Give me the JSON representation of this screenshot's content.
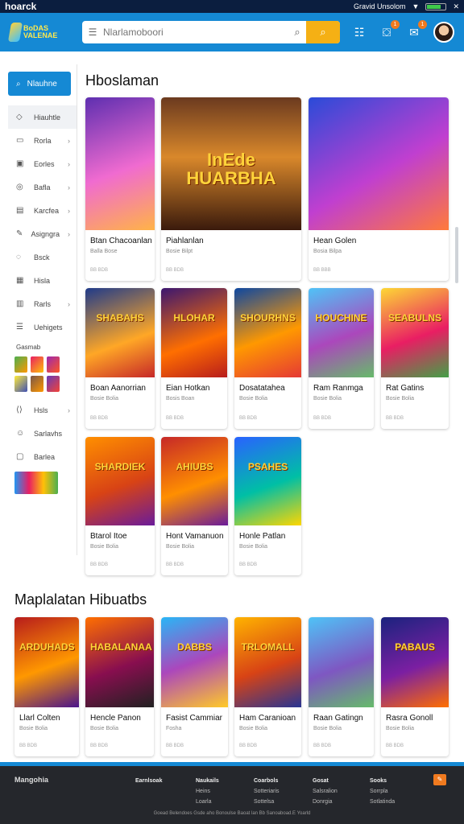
{
  "status_bar": {
    "app_name": "hoarck",
    "right_text": "Gravid Unsolom"
  },
  "header": {
    "logo_text": "BoDAS VALENAE",
    "search_placeholder": "Nlarlamoboori",
    "icons": [
      "menu-icon",
      "search-icon",
      "list-icon",
      "gift-icon",
      "notification-icon"
    ],
    "badges": [
      "1",
      "1"
    ]
  },
  "sidebar": {
    "home_label": "Nlauhne",
    "items": [
      {
        "label": "Hiauhtle",
        "icon": "tag-icon",
        "chevron": false
      },
      {
        "label": "Rorla",
        "icon": "folder-icon",
        "chevron": true
      },
      {
        "label": "Eorles",
        "icon": "image-icon",
        "chevron": true
      },
      {
        "label": "Bafla",
        "icon": "controller-icon",
        "chevron": true
      },
      {
        "label": "Karcfea",
        "icon": "chart-icon",
        "chevron": true
      },
      {
        "label": "Asigngra",
        "icon": "edit-icon",
        "chevron": true
      },
      {
        "label": "Bsck",
        "icon": "chat-icon",
        "chevron": false
      },
      {
        "label": "Hisla",
        "icon": "grid-icon",
        "chevron": false
      },
      {
        "label": "Rarls",
        "icon": "calendar-icon",
        "chevron": true
      },
      {
        "label": "Uehigets",
        "icon": "list-icon",
        "chevron": false
      }
    ],
    "section_label": "Gasmab",
    "bottom_items": [
      {
        "label": "Hsls",
        "icon": "code-icon",
        "chevron": true
      },
      {
        "label": "Sarlavhs",
        "icon": "avatar-icon",
        "chevron": false
      },
      {
        "label": "Barlea",
        "icon": "box-icon",
        "chevron": false
      }
    ]
  },
  "section1": {
    "title": "Hboslaman",
    "cards": [
      {
        "title": "Btan Chacoanlan",
        "sub": "Balla Bose",
        "meta": "BB BDB",
        "art_text": ""
      },
      {
        "title": "Piahlanlan",
        "sub": "Bosie Bilpt",
        "meta": "BB BDB",
        "art_text": "InEde HUARBHA"
      },
      {
        "title": "Hean Golen",
        "sub": "Bosia Bilpa",
        "meta": "BB BBB",
        "art_text": ""
      },
      {
        "title": "Boan Aanorrian",
        "sub": "Bosie Bolia",
        "meta": "BB BDB",
        "art_text": "SHABAHS"
      },
      {
        "title": "Eian Hotkan",
        "sub": "Bosis Boan",
        "meta": "BB BDB",
        "art_text": "HLOHAR"
      },
      {
        "title": "Dosatatahea",
        "sub": "Bosie Bolia",
        "meta": "BB BDB",
        "art_text": "SHOURHNS"
      },
      {
        "title": "Ram Ranmga",
        "sub": "Bosie Bolia",
        "meta": "BB BDB",
        "art_text": "HOUCHINE"
      },
      {
        "title": "Rat Gatins",
        "sub": "Bosie Bolia",
        "meta": "BB BDB",
        "art_text": "SEABULNS"
      },
      {
        "title": "Btarol Itoe",
        "sub": "Bosie Bolia",
        "meta": "BB BDB",
        "art_text": "SHARDIEK"
      },
      {
        "title": "Hont Vamanuon",
        "sub": "Bosie Bolia",
        "meta": "BB BDB",
        "art_text": "AHIUBS"
      },
      {
        "title": "Honle Patlan",
        "sub": "Bosie Bolia",
        "meta": "BB BDB",
        "art_text": "PSAHES"
      }
    ]
  },
  "section2": {
    "title": "Maplalatan Hibuatbs",
    "cards": [
      {
        "title": "Llarl Colten",
        "sub": "Bosie Bolia",
        "meta": "BB BDB",
        "art_text": "ARDUHADS"
      },
      {
        "title": "Hencle Panon",
        "sub": "Bosie Bolia",
        "meta": "BB BDB",
        "art_text": "HABALANAA"
      },
      {
        "title": "Fasist Cammiar",
        "sub": "Fosha",
        "meta": "BB BDB",
        "art_text": "DABBS"
      },
      {
        "title": "Ham Caranioan",
        "sub": "Bosie Bolia",
        "meta": "BB BDB",
        "art_text": "TRLOMALL"
      },
      {
        "title": "Raan Gatingn",
        "sub": "Bosie Bolia",
        "meta": "BB BDB",
        "art_text": ""
      },
      {
        "title": "Rasra Gonoll",
        "sub": "Bosie Bolia",
        "meta": "BB BDB",
        "art_text": "PABAUS"
      }
    ]
  },
  "footer": {
    "brand": "Mangohia",
    "columns": [
      {
        "head": "Earnlsoak",
        "lines": []
      },
      {
        "head": "Naukails",
        "lines": [
          "Heins",
          "Loarla"
        ]
      },
      {
        "head": "Coarbols",
        "lines": [
          "Sotteriaris",
          "Sottelsa"
        ]
      },
      {
        "head": "Gosat",
        "lines": [
          "Salsralion",
          "Donrgia"
        ]
      },
      {
        "head": "Sooks",
        "lines": [
          "Sorrpla",
          "Sotlatinda"
        ]
      }
    ],
    "copyright": "Goead Belendoes Gsde aho Bonoulse Baoat lan Bb Sanoaboad.E Yoarld"
  },
  "colors": {
    "header": "#1589d4",
    "accent": "#f5b014",
    "footer": "#25272c",
    "badge": "#f07a1f"
  }
}
